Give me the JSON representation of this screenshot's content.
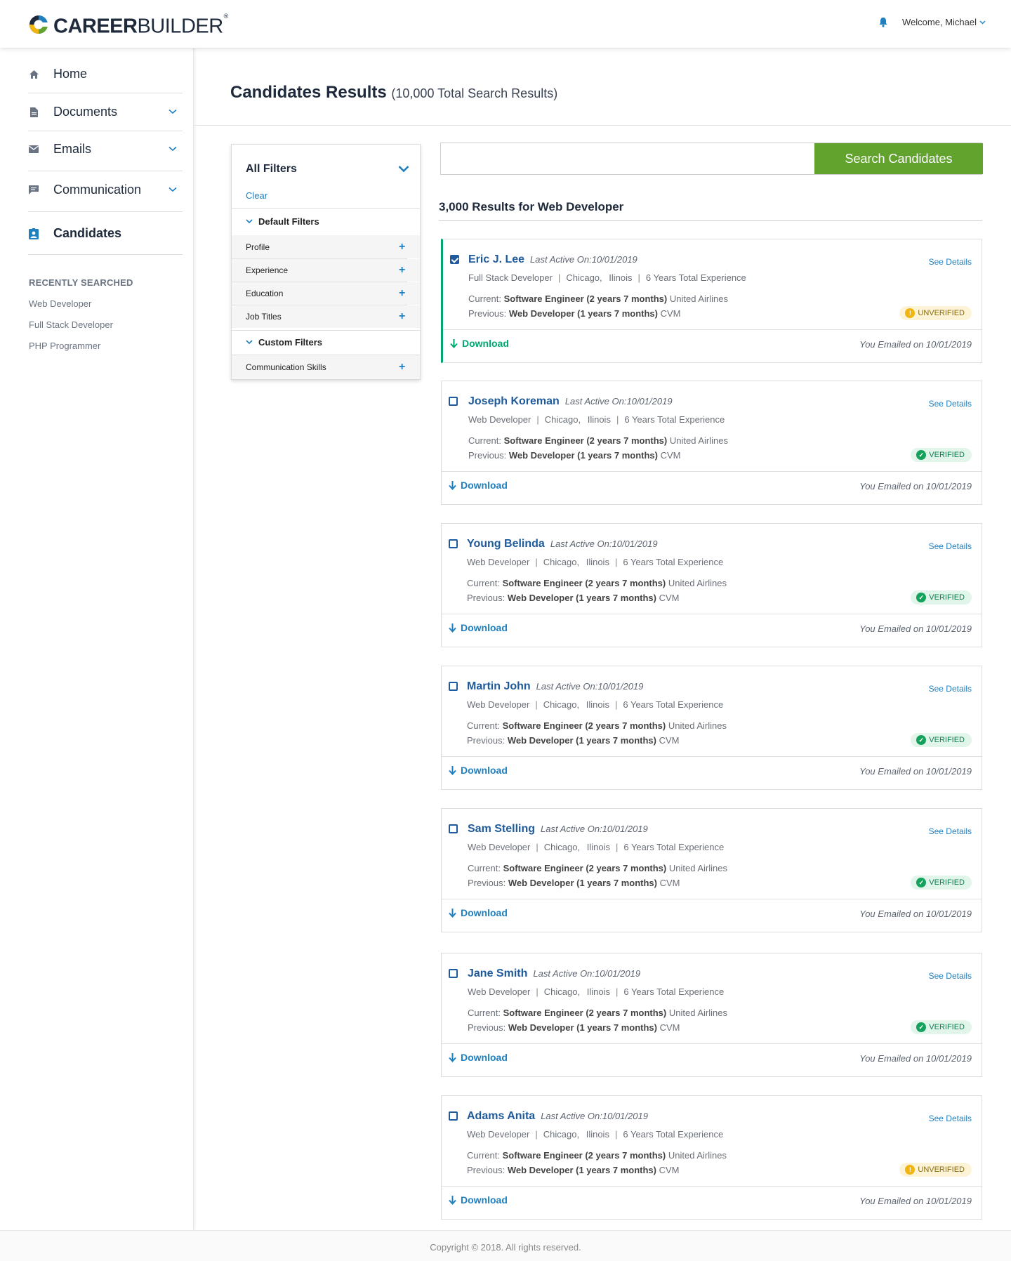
{
  "header": {
    "logo_bold": "CAREER",
    "logo_light": "BUILDER",
    "logo_reg": "®",
    "welcome": "Welcome, Michael"
  },
  "sidebar": {
    "items": [
      {
        "label": "Home",
        "icon": "home-icon"
      },
      {
        "label": "Documents",
        "icon": "document-icon"
      },
      {
        "label": "Emails",
        "icon": "mail-icon"
      },
      {
        "label": "Communication",
        "icon": "chat-icon"
      },
      {
        "label": "Candidates",
        "icon": "candidate-icon"
      }
    ],
    "recent_heading": "RECENTLY SEARCHED",
    "recent": [
      "Web Developer",
      "Full Stack Developer",
      "PHP Programmer"
    ]
  },
  "page": {
    "title": "Candidates Results",
    "subtitle": "(10,000 Total Search Results)"
  },
  "filters": {
    "title": "All Filters",
    "clear": "Clear",
    "default_heading": "Default Filters",
    "default_items": [
      "Profile",
      "Experience",
      "Education",
      "Job Titles"
    ],
    "custom_heading": "Custom Filters",
    "custom_items": [
      "Communication Skills"
    ]
  },
  "search": {
    "value": "",
    "button": "Search Candidates"
  },
  "results": {
    "heading": "3,000 Results for Web Developer",
    "see_details": "See Details",
    "download": "Download",
    "emailed": "You Emailed on 10/01/2019",
    "current_prefix": "Current:",
    "previous_prefix": "Previous:",
    "current_title": "Software Engineer (2 years 7 months)",
    "current_company": "United Airlines",
    "previous_title": "Web Developer (1 years 7 months)",
    "previous_company": "CVM",
    "candidates": [
      {
        "name": "Eric J. Lee",
        "last_active": "Last Active On:10/01/2019",
        "role": "Full Stack Developer",
        "city": "Chicago,",
        "state": "Ilinois",
        "experience": "6 Years Total Experience",
        "status": "UNVERIFIED",
        "selected": true
      },
      {
        "name": "Joseph Koreman",
        "last_active": "Last Active On:10/01/2019",
        "role": "Web Developer",
        "city": "Chicago,",
        "state": "Ilinois",
        "experience": "6 Years Total Experience",
        "status": "VERIFIED",
        "selected": false
      },
      {
        "name": "Young Belinda",
        "last_active": "Last Active On:10/01/2019",
        "role": "Web Developer",
        "city": "Chicago,",
        "state": "Ilinois",
        "experience": "6 Years Total Experience",
        "status": "VERIFIED",
        "selected": false
      },
      {
        "name": "Martin John",
        "last_active": "Last Active On:10/01/2019",
        "role": "Web Developer",
        "city": "Chicago,",
        "state": "Ilinois",
        "experience": "6 Years Total Experience",
        "status": "VERIFIED",
        "selected": false
      },
      {
        "name": "Sam Stelling",
        "last_active": "Last Active On:10/01/2019",
        "role": "Web Developer",
        "city": "Chicago,",
        "state": "Ilinois",
        "experience": "6 Years Total Experience",
        "status": "VERIFIED",
        "selected": false
      },
      {
        "name": "Jane Smith",
        "last_active": "Last Active On:10/01/2019",
        "role": "Web Developer",
        "city": "Chicago,",
        "state": "Ilinois",
        "experience": "6 Years Total Experience",
        "status": "VERIFIED",
        "selected": false
      },
      {
        "name": "Adams Anita",
        "last_active": "Last Active On:10/01/2019",
        "role": "Web Developer",
        "city": "Chicago,",
        "state": "Ilinois",
        "experience": "6 Years Total Experience",
        "status": "UNVERIFIED",
        "selected": false
      }
    ]
  },
  "footer": {
    "copyright": "Copyright © 2018. All rights reserved."
  },
  "colors": {
    "accent_blue": "#1f7fbf",
    "brand_navy": "#1e2a3b",
    "search_green": "#61a32d",
    "selected_green": "#00a870",
    "verified_green": "#14a25d",
    "unverified_yellow": "#f0b510"
  }
}
